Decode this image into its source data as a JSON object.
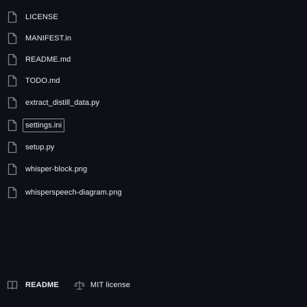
{
  "files": [
    {
      "name": "LICENSE",
      "icon": "file-icon",
      "highlighted": false
    },
    {
      "name": "MANIFEST.in",
      "icon": "file-icon",
      "highlighted": false
    },
    {
      "name": "README.md",
      "icon": "file-icon",
      "highlighted": false
    },
    {
      "name": "TODO.md",
      "icon": "file-icon",
      "highlighted": false
    },
    {
      "name": "extract_distill_data.py",
      "icon": "file-icon",
      "highlighted": false
    },
    {
      "name": "settings.ini",
      "icon": "file-icon",
      "highlighted": true
    },
    {
      "name": "setup.py",
      "icon": "file-icon",
      "highlighted": false
    },
    {
      "name": "whisper-block.png",
      "icon": "file-icon",
      "highlighted": false
    },
    {
      "name": "whisperspeech-diagram.png",
      "icon": "file-icon",
      "highlighted": false
    }
  ],
  "footer": {
    "readme_label": "README",
    "readme_icon": "book-icon",
    "license_label": "MIT license",
    "license_icon": "scale-icon"
  },
  "colors": {
    "background": "#0d1117",
    "text": "#e6edf3",
    "icon": "#7d8590",
    "highlight_border": "#8b949e"
  }
}
